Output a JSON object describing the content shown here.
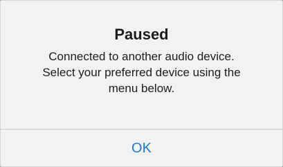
{
  "alert": {
    "title": "Paused",
    "message_lines": [
      "Connected to another audio device.",
      "Select your preferred device using the",
      "menu below."
    ],
    "ok_label": "OK"
  },
  "colors": {
    "background": "#f2f2f2",
    "text": "#1c1c1e",
    "accent": "#1a7bd4",
    "divider": "#c8c8cc"
  }
}
